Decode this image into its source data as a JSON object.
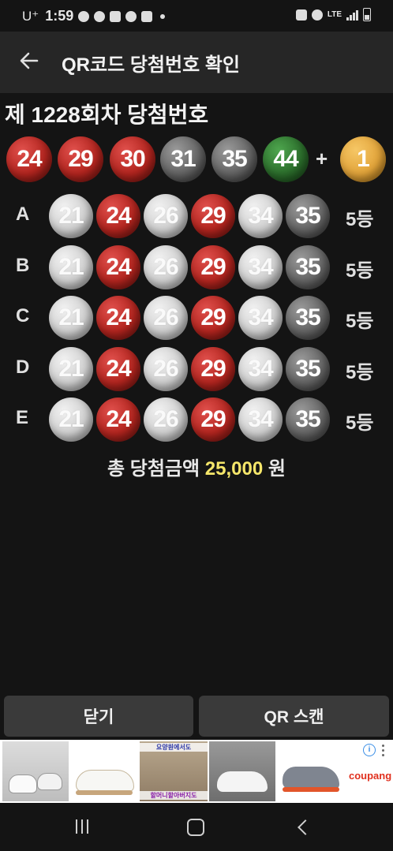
{
  "status": {
    "carrier": "U⁺",
    "time": "1:59",
    "network": "LTE"
  },
  "appbar": {
    "title": "QR코드 당첨번호 확인",
    "back_icon": "arrow-left-icon"
  },
  "draw": {
    "round_title": "제 1228회차 당첨번호",
    "numbers": [
      {
        "n": "24",
        "color": "red"
      },
      {
        "n": "29",
        "color": "red"
      },
      {
        "n": "30",
        "color": "red"
      },
      {
        "n": "31",
        "color": "dark"
      },
      {
        "n": "35",
        "color": "dark"
      },
      {
        "n": "44",
        "color": "green"
      }
    ],
    "plus": "+",
    "bonus": {
      "n": "1",
      "color": "gold"
    }
  },
  "tickets": [
    {
      "label": "A",
      "numbers": [
        "21",
        "24",
        "26",
        "29",
        "34",
        "35"
      ],
      "matched": [
        false,
        true,
        false,
        true,
        false,
        true
      ],
      "rank": "5등"
    },
    {
      "label": "B",
      "numbers": [
        "21",
        "24",
        "26",
        "29",
        "34",
        "35"
      ],
      "matched": [
        false,
        true,
        false,
        true,
        false,
        true
      ],
      "rank": "5등"
    },
    {
      "label": "C",
      "numbers": [
        "21",
        "24",
        "26",
        "29",
        "34",
        "35"
      ],
      "matched": [
        false,
        true,
        false,
        true,
        false,
        true
      ],
      "rank": "5등"
    },
    {
      "label": "D",
      "numbers": [
        "21",
        "24",
        "26",
        "29",
        "34",
        "35"
      ],
      "matched": [
        false,
        true,
        false,
        true,
        false,
        true
      ],
      "rank": "5등"
    },
    {
      "label": "E",
      "numbers": [
        "21",
        "24",
        "26",
        "29",
        "34",
        "35"
      ],
      "matched": [
        false,
        true,
        false,
        true,
        false,
        true
      ],
      "rank": "5등"
    }
  ],
  "total": {
    "prefix": "총 당첨금액",
    "amount": "25,000",
    "suffix": "원"
  },
  "buttons": {
    "close": "닫기",
    "scan": "QR 스캔"
  },
  "ad": {
    "banner_text_1": "요양원에서도",
    "banner_text_2": "할머니할아버지도",
    "brand": "coupang"
  },
  "colors": {
    "red": "#b3251f",
    "dark": "#646464",
    "green": "#2c6e2c",
    "gold": "#e2a43a",
    "light": "#cfcfcf",
    "amount": "#f5e66a"
  }
}
